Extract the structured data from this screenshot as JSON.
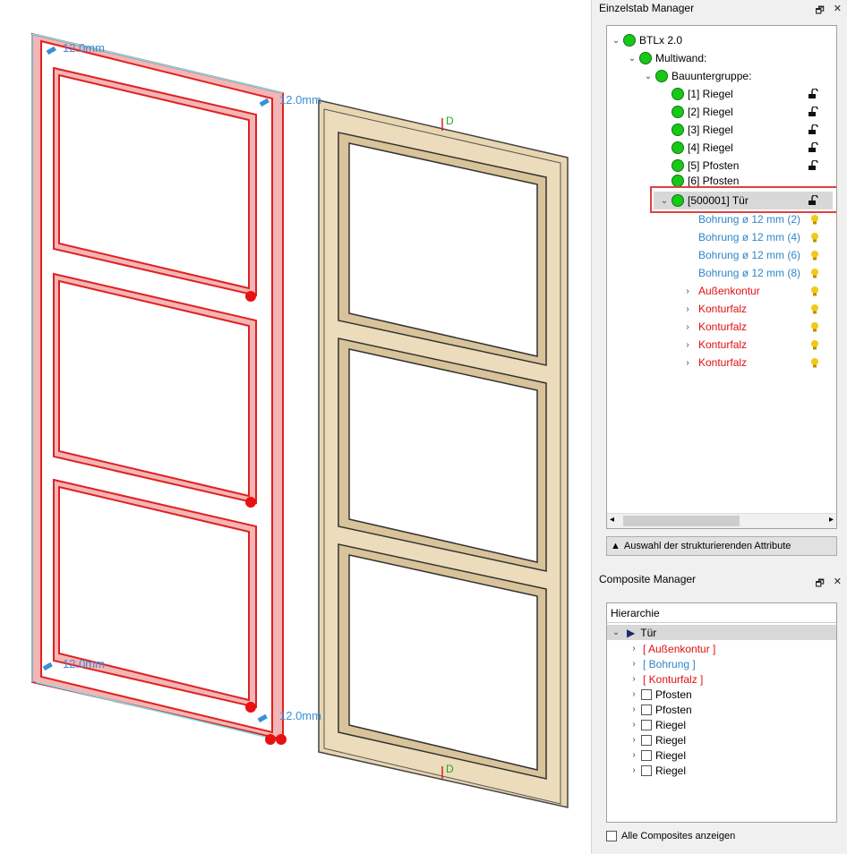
{
  "viewport": {
    "dim_labels": [
      "12.0mm",
      "12.0mm",
      "12.0mm",
      "12.0mm"
    ],
    "axis_marker": "D",
    "colors": {
      "outline": "#e02020",
      "wood": "#e6d3ad",
      "dim": "#3a8fd8"
    }
  },
  "einzelstab": {
    "title": "Einzelstab Manager",
    "btn_float": "🗗",
    "btn_close": "✕",
    "tree": {
      "root": "BTLx 2.0",
      "multiwand": "Multiwand:",
      "bauuntergruppe": "Bauuntergruppe:",
      "members": [
        "[1] Riegel",
        "[2] Riegel",
        "[3] Riegel",
        "[4] Riegel",
        "[5] Pfosten",
        "[6] Pfosten"
      ],
      "selected": "[500001] Tür",
      "bohrungen": [
        "Bohrung ø 12 mm (2)",
        "Bohrung ø 12 mm (4)",
        "Bohrung ø 12 mm (6)",
        "Bohrung ø 12 mm (8)"
      ],
      "contours": [
        "Außenkontur",
        "Konturfalz",
        "Konturfalz",
        "Konturfalz",
        "Konturfalz"
      ]
    },
    "attr_button": "Auswahl der strukturierenden Attribute"
  },
  "composite": {
    "title": "Composite Manager",
    "btn_float": "🗗",
    "btn_close": "✕",
    "header": "Hierarchie",
    "root": "Tür",
    "groups": [
      "[ Außenkontur ]",
      "[ Bohrung ]",
      "[ Konturfalz ]"
    ],
    "items": [
      "Pfosten",
      "Pfosten",
      "Riegel",
      "Riegel",
      "Riegel",
      "Riegel"
    ],
    "show_all": "Alle Composites anzeigen"
  }
}
